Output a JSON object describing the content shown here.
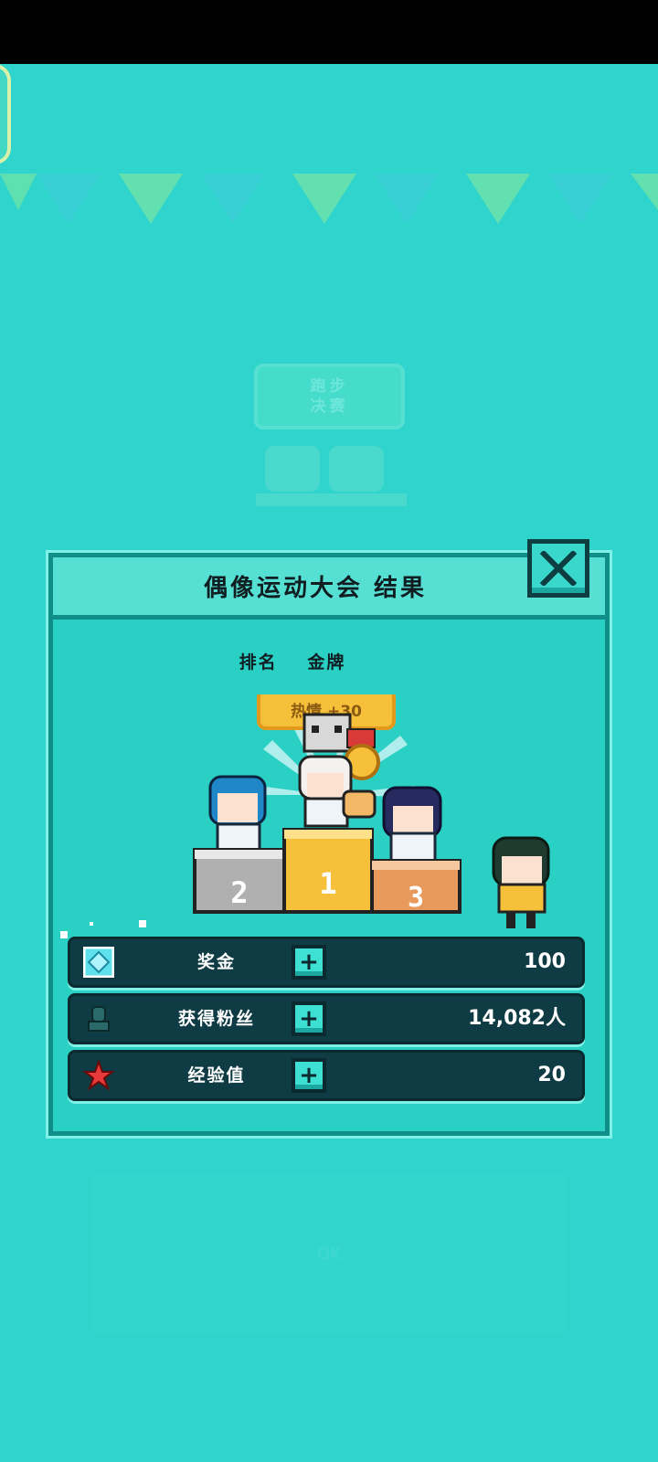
{
  "background": {
    "faded_sign_line1": "跑步",
    "faded_sign_line2": "决赛",
    "faded_button_text": "OK"
  },
  "dialog": {
    "title": "偶像运动大会 结果",
    "rank_label": "排名",
    "rank_value": "金牌",
    "popularity_banner": "热情 +30",
    "podium": {
      "second": "2",
      "first": "1",
      "third": "3"
    }
  },
  "stats": [
    {
      "icon": "diamond-icon",
      "label": "奖金",
      "value": "100"
    },
    {
      "icon": "fan-icon",
      "label": "获得粉丝",
      "value": "14,082人"
    },
    {
      "icon": "star-icon",
      "label": "经验值",
      "value": "20"
    }
  ],
  "colors": {
    "background": "#2fd4cc",
    "dialog_border": "#0f8e8a",
    "stat_row": "#0f3c44",
    "gold": "#f6c03a",
    "silver": "#b0b0b0",
    "bronze": "#e89a5c"
  }
}
